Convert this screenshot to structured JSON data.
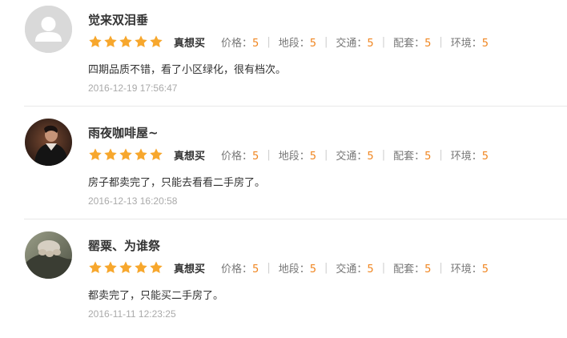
{
  "colors": {
    "star": "#f7a72d",
    "score_value": "#f0851f"
  },
  "reviews": [
    {
      "username": "觉来双泪垂",
      "avatar": "default-avatar",
      "stars": 5,
      "tag": "真想买",
      "scores": [
        {
          "label": "价格：",
          "value": "5"
        },
        {
          "label": "地段：",
          "value": "5"
        },
        {
          "label": "交通：",
          "value": "5"
        },
        {
          "label": "配套：",
          "value": "5"
        },
        {
          "label": "环境：",
          "value": "5"
        }
      ],
      "comment": "四期品质不错，看了小区绿化，很有档次。",
      "date": "2016-12-19 17:56:47"
    },
    {
      "username": "雨夜咖啡屋~",
      "avatar": "user-photo-avatar",
      "stars": 5,
      "tag": "真想买",
      "scores": [
        {
          "label": "价格：",
          "value": "5"
        },
        {
          "label": "地段：",
          "value": "5"
        },
        {
          "label": "交通：",
          "value": "5"
        },
        {
          "label": "配套：",
          "value": "5"
        },
        {
          "label": "环境：",
          "value": "5"
        }
      ],
      "comment": "房子都卖完了，只能去看看二手房了。",
      "date": "2016-12-13 16:20:58"
    },
    {
      "username": "罂粟、为谁祭",
      "avatar": "cat-paw-avatar",
      "stars": 5,
      "tag": "真想买",
      "scores": [
        {
          "label": "价格：",
          "value": "5"
        },
        {
          "label": "地段：",
          "value": "5"
        },
        {
          "label": "交通：",
          "value": "5"
        },
        {
          "label": "配套：",
          "value": "5"
        },
        {
          "label": "环境：",
          "value": "5"
        }
      ],
      "comment": "都卖完了，只能买二手房了。",
      "date": "2016-11-11 12:23:25"
    }
  ]
}
